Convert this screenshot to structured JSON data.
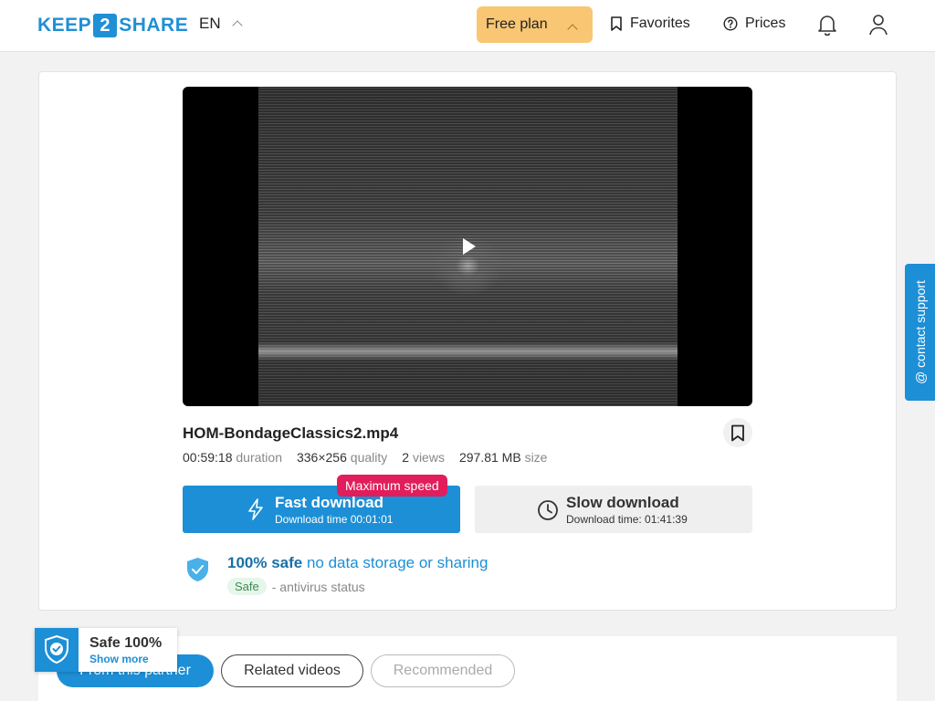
{
  "header": {
    "logo_left": "KEEP",
    "logo_num": "2",
    "logo_right": "SHARE",
    "language": "EN",
    "plan_label": "Free plan",
    "favorites_label": "Favorites",
    "prices_label": "Prices"
  },
  "file": {
    "name": "HOM-BondageClassics2.mp4",
    "duration_value": "00:59:18",
    "duration_label": "duration",
    "quality_value": "336×256",
    "quality_label": "quality",
    "views_value": "2",
    "views_label": "views",
    "size_value": "297.81 MB",
    "size_label": "size"
  },
  "download": {
    "fast_title": "Fast download",
    "fast_time": "Download time 00:01:01",
    "max_badge": "Maximum speed",
    "slow_title": "Slow download",
    "slow_time": "Download time: 01:41:39"
  },
  "safety": {
    "bold": "100% safe",
    "rest": "no data storage or sharing",
    "pill": "Safe",
    "status": "- antivirus status"
  },
  "support": {
    "label": "@ contact support"
  },
  "tabs": {
    "partner": "From this partner",
    "related": "Related videos",
    "recommended": "Recommended"
  },
  "safe_badge": {
    "title": "Safe 100%",
    "link": "Show more"
  },
  "colors": {
    "accent": "#1c8fd6",
    "plan": "#f9c673",
    "badge": "#e11d5c"
  }
}
